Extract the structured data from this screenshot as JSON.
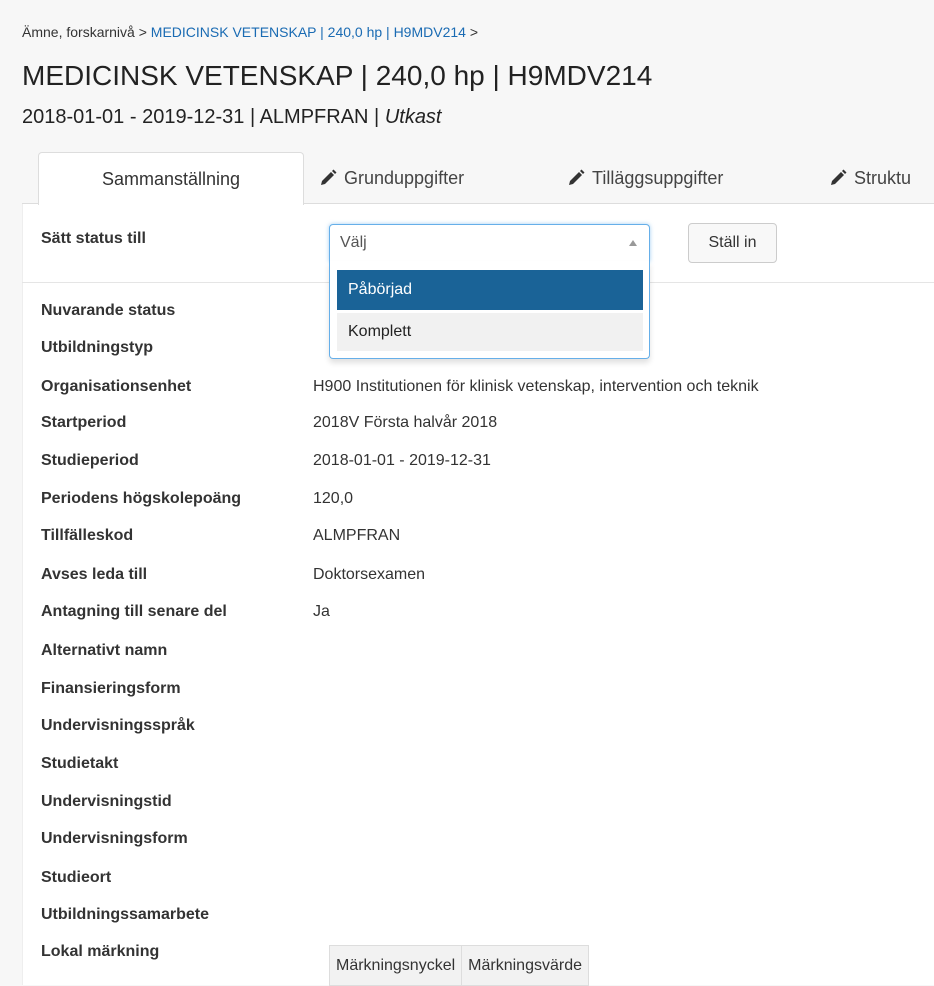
{
  "breadcrumb": {
    "item1": "Ämne, forskarnivå",
    "sep": ">",
    "item2": "MEDICINSK VETENSKAP | 240,0 hp | H9MDV214"
  },
  "header": {
    "title": "MEDICINSK VETENSKAP | 240,0 hp | H9MDV214",
    "subtitle_main": "2018-01-01 - 2019-12-31 | ALMPFRAN | ",
    "subtitle_status": "Utkast"
  },
  "tabs": [
    {
      "label": "Sammanställning",
      "active": true
    },
    {
      "label": "Grunduppgifter",
      "icon": "pencil-icon"
    },
    {
      "label": "Tilläggsuppgifter",
      "icon": "pencil-icon"
    },
    {
      "label": "Struktu",
      "icon": "pencil-icon"
    }
  ],
  "status_form": {
    "label": "Sätt status till",
    "select_value": "Välj",
    "options": [
      "Påbörjad",
      "Komplett"
    ],
    "button_label": "Ställ in"
  },
  "fields": [
    {
      "label": "Nuvarande status",
      "value": ""
    },
    {
      "label": "Utbildningstyp",
      "value": ""
    },
    {
      "label": "Organisationsenhet",
      "value": "H900 Institutionen för klinisk vetenskap, intervention och teknik"
    },
    {
      "label": "Startperiod",
      "value": "2018V Första halvår 2018"
    },
    {
      "label": "Studieperiod",
      "value": "2018-01-01 - 2019-12-31"
    },
    {
      "label": "Periodens högskolepoäng",
      "value": "120,0"
    },
    {
      "label": "Tillfälleskod",
      "value": "ALMPFRAN"
    },
    {
      "label": "Avses leda till",
      "value": "Doktorsexamen"
    },
    {
      "label": "Antagning till senare del",
      "value": "Ja"
    },
    {
      "label": "Alternativt namn",
      "value": ""
    },
    {
      "label": "Finansieringsform",
      "value": ""
    },
    {
      "label": "Undervisningsspråk",
      "value": ""
    },
    {
      "label": "Studietakt",
      "value": ""
    },
    {
      "label": "Undervisningstid",
      "value": ""
    },
    {
      "label": "Undervisningsform",
      "value": ""
    },
    {
      "label": "Studieort",
      "value": ""
    },
    {
      "label": "Utbildningssamarbete",
      "value": ""
    },
    {
      "label": "Lokal märkning",
      "value": ""
    }
  ],
  "marking_table": {
    "headers": [
      "Märkningsnyckel",
      "Märkningsvärde"
    ]
  },
  "colors": {
    "link": "#1a6bb3",
    "selected_option": "#1a6397"
  }
}
